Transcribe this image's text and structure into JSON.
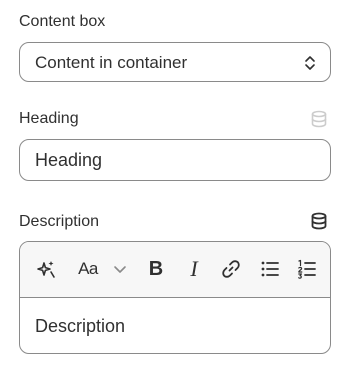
{
  "content_box": {
    "label": "Content box",
    "selected_value": "Content in container"
  },
  "heading": {
    "label": "Heading",
    "value": "Heading",
    "dynamic_source_icon": "database-icon",
    "dynamic_source_state": "disabled"
  },
  "description": {
    "label": "Description",
    "dynamic_source_icon": "database-icon",
    "content": "Description",
    "toolbar": [
      {
        "name": "magic-icon"
      },
      {
        "name": "font-style-icon",
        "text": "Aa"
      },
      {
        "name": "chevron-down-icon"
      },
      {
        "name": "bold-icon",
        "text": "B"
      },
      {
        "name": "italic-icon",
        "text": "I"
      },
      {
        "name": "link-icon"
      },
      {
        "name": "bullet-list-icon"
      },
      {
        "name": "numbered-list-icon"
      }
    ]
  },
  "colors": {
    "text": "#303030",
    "border": "#8a8a8a",
    "toolbar_bg": "#f7f7f7",
    "muted_icon": "#cccccc"
  }
}
